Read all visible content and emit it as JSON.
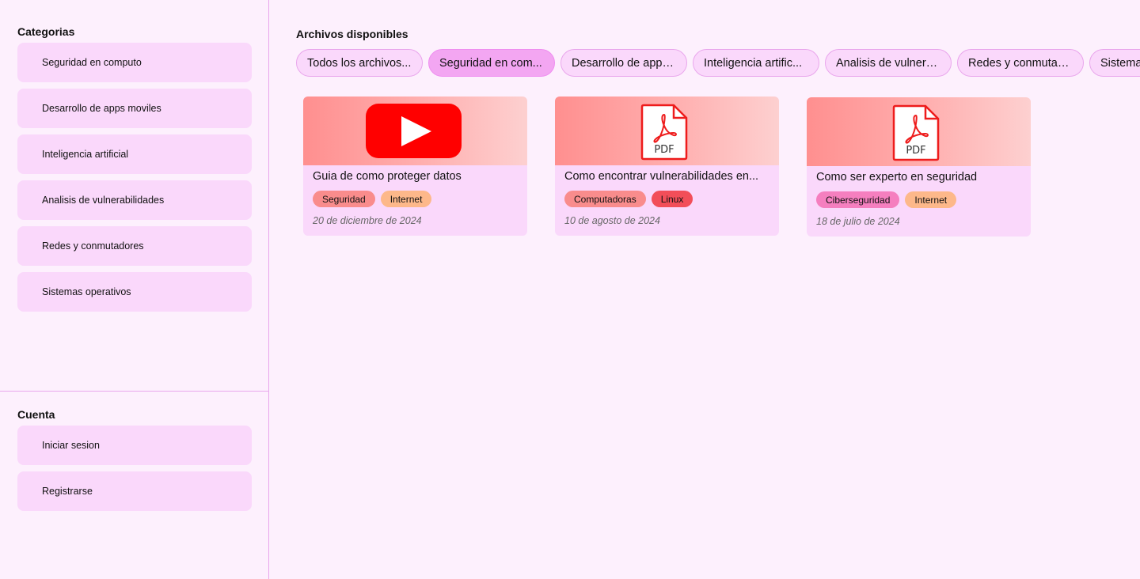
{
  "sidebar": {
    "categories_title": "Categorias",
    "categories": [
      {
        "label": "Seguridad en computo"
      },
      {
        "label": "Desarrollo de apps moviles"
      },
      {
        "label": "Inteligencia artificial"
      },
      {
        "label": "Analisis de vulnerabilidades"
      },
      {
        "label": "Redes y conmutadores"
      },
      {
        "label": "Sistemas operativos"
      }
    ],
    "account_title": "Cuenta",
    "account": [
      {
        "label": "Iniciar sesion"
      },
      {
        "label": "Registrarse"
      }
    ]
  },
  "main": {
    "title": "Archivos disponibles",
    "filters": [
      {
        "label": "Todos los archivos..."
      },
      {
        "label": "Seguridad en com...",
        "active": true
      },
      {
        "label": "Desarrollo de apps..."
      },
      {
        "label": "Inteligencia artific..."
      },
      {
        "label": "Analisis de vulnera..."
      },
      {
        "label": "Redes y conmutad..."
      },
      {
        "label": "Sistemas operativos"
      }
    ],
    "files": [
      {
        "icon": "youtube-icon",
        "title": "Guia de como proteger datos",
        "tags": [
          {
            "label": "Seguridad",
            "color": "#f98c8c"
          },
          {
            "label": "Internet",
            "color": "#fdb88a"
          }
        ],
        "date": "20 de diciembre de 2024"
      },
      {
        "icon": "pdf-icon",
        "icon_text": "PDF",
        "title": "Como encontrar vulnerabilidades en...",
        "tags": [
          {
            "label": "Computadoras",
            "color": "#f98c8c"
          },
          {
            "label": "Linux",
            "color": "#f24e59"
          }
        ],
        "date": "10 de agosto de 2024"
      },
      {
        "icon": "pdf-icon",
        "icon_text": "PDF",
        "title": "Como ser experto en seguridad",
        "tags": [
          {
            "label": "Ciberseguridad",
            "color": "#f57fbf"
          },
          {
            "label": "Internet",
            "color": "#fdb88a"
          }
        ],
        "date": "18 de julio de 2024"
      }
    ]
  },
  "colors": {
    "background": "#fdf0fd",
    "item_background": "#fad8fb",
    "border": "#e9a6ec",
    "active_chip": "#f3a6f2",
    "youtube_red": "#ff0000",
    "pdf_red": "#ee1c1c"
  }
}
